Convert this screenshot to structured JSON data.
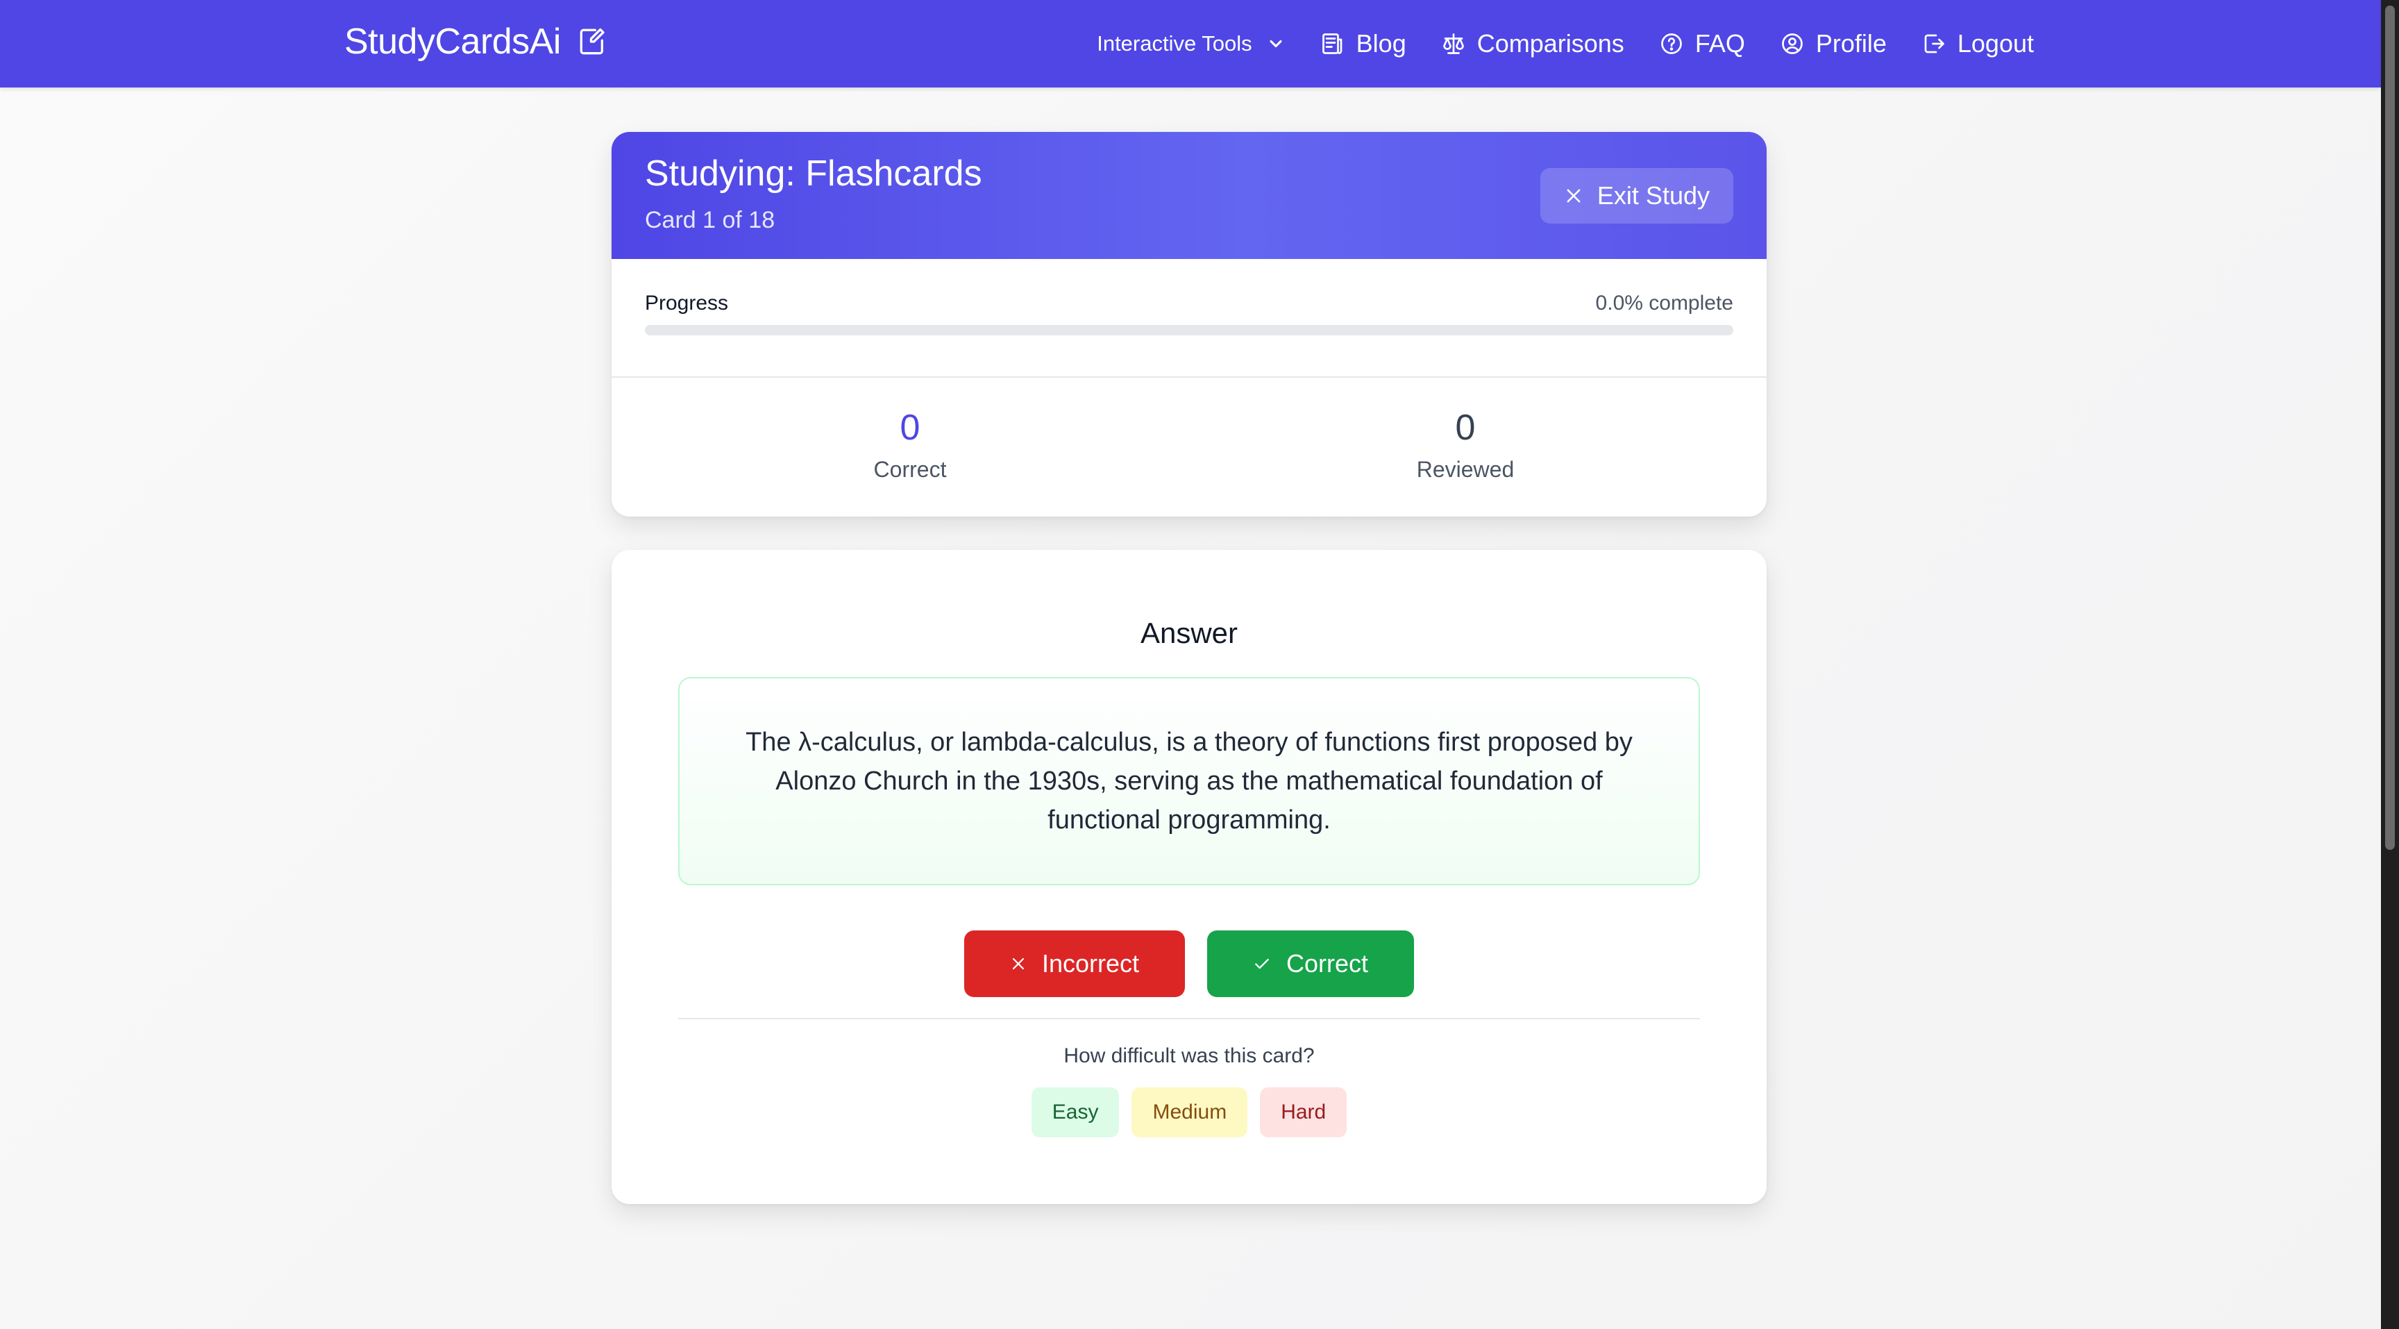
{
  "nav": {
    "brand": "StudyCardsAi",
    "links": {
      "tools": "Interactive Tools",
      "blog": "Blog",
      "comparisons": "Comparisons",
      "faq": "FAQ",
      "profile": "Profile",
      "logout": "Logout"
    }
  },
  "study": {
    "title": "Studying: Flashcards",
    "card_counter": "Card 1 of 18",
    "exit_label": "Exit Study",
    "progress_label": "Progress",
    "progress_text": "0.0% complete",
    "progress_fraction": 0.0,
    "stats": {
      "correct_value": "0",
      "correct_label": "Correct",
      "reviewed_value": "0",
      "reviewed_label": "Reviewed"
    }
  },
  "answer": {
    "title": "Answer",
    "text": "The λ-calculus, or lambda-calculus, is a theory of functions first proposed by Alonzo Church in the 1930s, serving as the mathematical foundation of functional programming.",
    "incorrect_label": "Incorrect",
    "correct_label": "Correct",
    "difficulty_question": "How difficult was this card?",
    "difficulty": {
      "easy": "Easy",
      "medium": "Medium",
      "hard": "Hard"
    }
  },
  "colors": {
    "brand": "#4f46e5",
    "incorrect": "#dc2626",
    "correct": "#16a34a"
  },
  "icons": {
    "brand": "edit-square-icon",
    "tools": "chevron-down-icon",
    "blog": "newspaper-icon",
    "comparisons": "scale-icon",
    "faq": "question-circle-icon",
    "profile": "user-circle-icon",
    "logout": "logout-icon",
    "exit": "close-icon",
    "incorrect": "close-icon",
    "correct": "check-icon"
  }
}
